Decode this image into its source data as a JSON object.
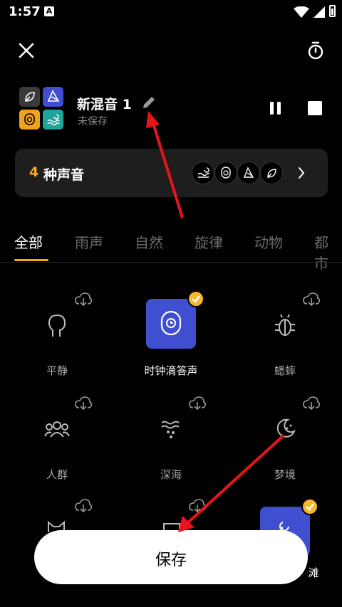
{
  "status_bar": {
    "time": "1:57",
    "notification_icon": "A"
  },
  "header": {
    "close_icon": "close-icon",
    "timer_icon": "timer-icon"
  },
  "mix": {
    "name": "新混音 1",
    "subtitle": "未保存"
  },
  "card": {
    "count": "4",
    "label": "种声音"
  },
  "tabs": [
    {
      "label": "全部",
      "active": true
    },
    {
      "label": "雨声"
    },
    {
      "label": "自然"
    },
    {
      "label": "旋律"
    },
    {
      "label": "动物"
    },
    {
      "label": "都市"
    }
  ],
  "sounds": [
    {
      "label": "平静",
      "icon": "head-icon"
    },
    {
      "label": "时钟滴答声",
      "icon": "clock-icon",
      "selected": true
    },
    {
      "label": "蟋蟀",
      "icon": "bug-icon"
    },
    {
      "label": "人群",
      "icon": "crowd-icon"
    },
    {
      "label": "深海",
      "icon": "deep-sea-icon"
    },
    {
      "label": "梦境",
      "icon": "moon-icon"
    },
    {
      "label": "",
      "icon": "cat-icon"
    },
    {
      "label": "",
      "icon": "window-icon"
    },
    {
      "label": "滩",
      "icon": "beach-icon",
      "selected": true
    }
  ],
  "save_button": {
    "label": "保存"
  },
  "colors": {
    "accent": "#f5a623",
    "selected_tile": "#3f4fd0",
    "annotation": "#e8141b"
  }
}
